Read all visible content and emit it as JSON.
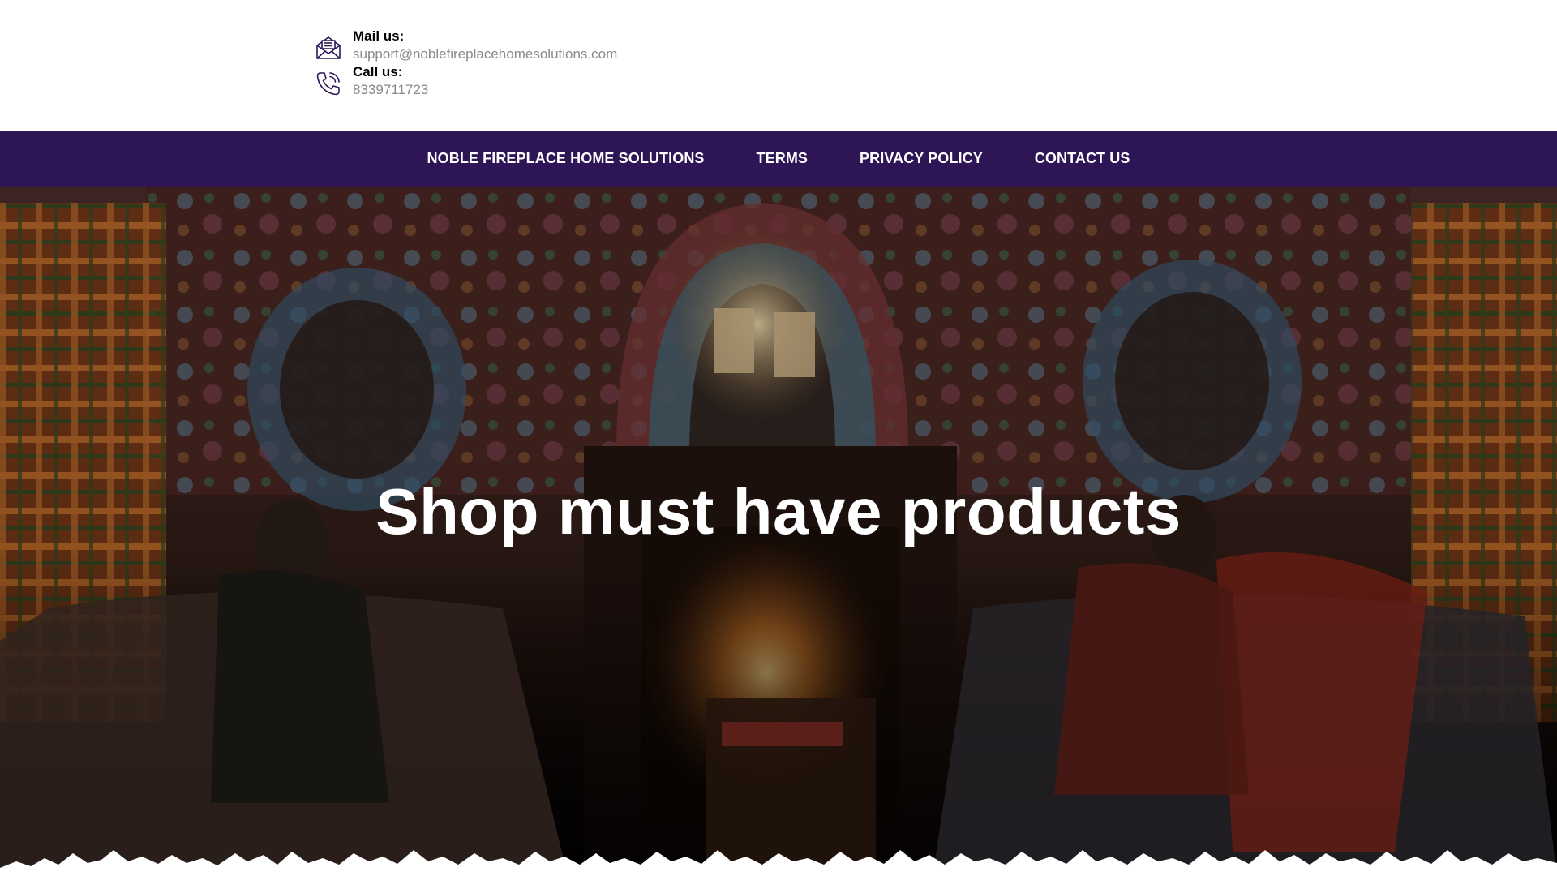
{
  "contact": {
    "mail_label": "Mail us:",
    "mail_value": "support@noblefireplacehomesolutions.com",
    "phone_label": "Call us:",
    "phone_value": "8339711723",
    "icon_color": "#2e1656"
  },
  "nav": {
    "items": [
      {
        "label": "NOBLE FIREPLACE HOME SOLUTIONS"
      },
      {
        "label": "TERMS"
      },
      {
        "label": "PRIVACY POLICY"
      },
      {
        "label": "CONTACT US"
      }
    ],
    "background": "#2e1656"
  },
  "hero": {
    "title": "Shop must have products"
  }
}
